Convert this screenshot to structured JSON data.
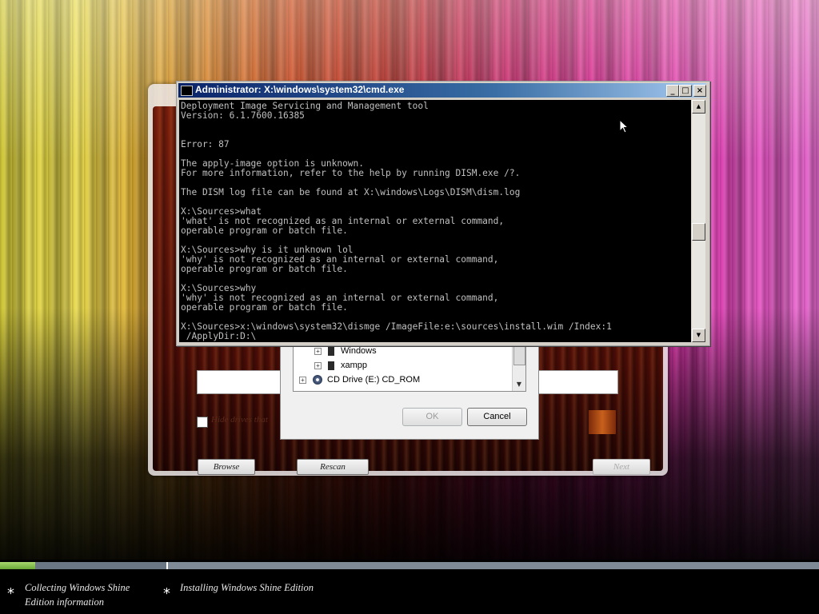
{
  "setup": {
    "hidden_drives_label": "Hide drives that",
    "browse_label": "Browse",
    "rescan_label": "Rescan",
    "next_label": "Next"
  },
  "folder_dialog": {
    "tree_items": [
      {
        "label": "Windows",
        "icon": "folder-icon"
      },
      {
        "label": "xampp",
        "icon": "folder-icon"
      },
      {
        "label": "CD Drive (E:) CD_ROM",
        "icon": "cd-drive-icon"
      }
    ],
    "ok_label": "OK",
    "cancel_label": "Cancel"
  },
  "cmd": {
    "title": "Administrator: X:\\windows\\system32\\cmd.exe",
    "lines": [
      "Deployment Image Servicing and Management tool",
      "Version: 6.1.7600.16385",
      "",
      "",
      "Error: 87",
      "",
      "The apply-image option is unknown.",
      "For more information, refer to the help by running DISM.exe /?.",
      "",
      "The DISM log file can be found at X:\\windows\\Logs\\DISM\\dism.log",
      "",
      "X:\\Sources>what",
      "'what' is not recognized as an internal or external command,",
      "operable program or batch file.",
      "",
      "X:\\Sources>why is it unknown lol",
      "'why' is not recognized as an internal or external command,",
      "operable program or batch file.",
      "",
      "X:\\Sources>why",
      "'why' is not recognized as an internal or external command,",
      "operable program or batch file.",
      "",
      "X:\\Sources>x:\\windows\\system32\\dismge /ImageFile:e:\\sources\\install.wim /Index:1",
      " /ApplyDir:D:\\"
    ],
    "scroll_position": 0.55
  },
  "progress": {
    "fraction": 0.043,
    "steps": [
      {
        "label": "Collecting Windows Shine Edition information"
      },
      {
        "label": "Installing Windows Shine Edition"
      }
    ]
  },
  "colors": {
    "console_bg": "#000000",
    "console_text": "#c0c0c0",
    "titlebar_start": "#0a246a",
    "progress_fill": "#8cc850"
  }
}
